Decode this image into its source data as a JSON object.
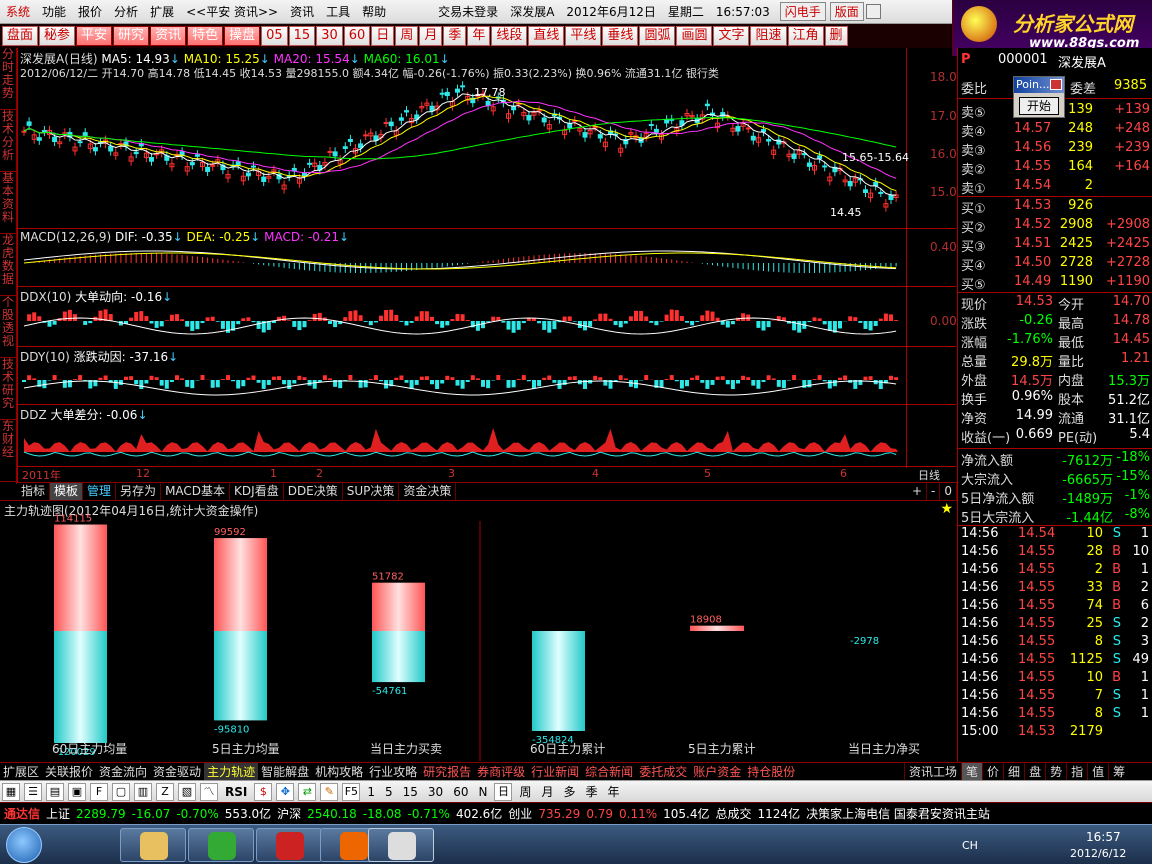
{
  "menu": {
    "items": [
      "系统",
      "功能",
      "报价",
      "分析",
      "扩展",
      "<<平安 资讯>>",
      "资讯",
      "工具",
      "帮助"
    ],
    "login": "交易未登录",
    "stock": "深发展A",
    "date": "2012年6月12日",
    "weekday": "星期二",
    "time": "16:57:03",
    "flash": "闪电手",
    "layout": "版面"
  },
  "toolbar": [
    "盘面",
    "秘参",
    "平安",
    "研究",
    "资讯",
    "特色",
    "操盘",
    "05",
    "15",
    "30",
    "60",
    "日",
    "周",
    "月",
    "季",
    "年",
    "线段",
    "直线",
    "平线",
    "垂线",
    "圆弧",
    "画圆",
    "文字",
    "阻速",
    "江角",
    "删"
  ],
  "logo": {
    "name": "分析家公式网",
    "url": "www.88gs.com"
  },
  "leftnav": [
    "分时走势",
    "技术分析",
    "基本资料",
    "龙虎数据",
    "个股透视",
    "技术研究",
    "东财经"
  ],
  "kline": {
    "title": "深发展A(日线)",
    "ma5": "MA5: 14.93",
    "ma10": "MA10: 15.25",
    "ma20": "MA20: 15.54",
    "ma60": "MA60: 16.01",
    "info": "2012/06/12/二 开14.70 高14.78 低14.45 收14.53 量298155.0 额4.34亿 幅-0.26(-1.76%) 振0.33(2.23%) 换0.96% 流通31.1亿 银行类",
    "high_mark": "17.78",
    "low_mark": "14.45",
    "range_mark": "15.65-15.64",
    "ticks": [
      "18.00",
      "17.00",
      "16.00",
      "15.00"
    ]
  },
  "macd": {
    "title": "MACD(12,26,9)",
    "dif": "DIF: -0.35",
    "dea": "DEA: -0.25",
    "macd": "MACD: -0.21",
    "tick": "0.40"
  },
  "ddx": {
    "title": "DDX(10)",
    "desc": "大单动向: -0.16",
    "tick": "0.00"
  },
  "ddy": {
    "title": "DDY(10)",
    "desc": "涨跌动因: -37.16"
  },
  "ddz": {
    "title": "DDZ",
    "desc": "大单差分: -0.06"
  },
  "xaxis": [
    "2011年",
    "12",
    "1",
    "2",
    "3",
    "4",
    "5",
    "6"
  ],
  "period": "日线",
  "tabs": [
    "指标",
    "模板",
    "管理",
    "另存为",
    "MACD基本",
    "KDJ看盘",
    "DDE决策",
    "SUP决策",
    "资金决策"
  ],
  "flow": {
    "title": "主力轨迹图(2012年04月16日,统计大资金操作)",
    "bars": [
      {
        "label": "60日主力均量",
        "pos": 114115,
        "neg": -120029
      },
      {
        "label": "5日主力均量",
        "pos": 99592,
        "neg": -95810
      },
      {
        "label": "当日主力买卖",
        "pos": 51782,
        "neg": -54761
      },
      {
        "label": "60日主力累计",
        "pos": null,
        "neg": -354824
      },
      {
        "label": "5日主力累计",
        "pos": 18908,
        "neg": null
      },
      {
        "label": "当日主力净买",
        "pos": null,
        "neg": -2978
      }
    ]
  },
  "quote": {
    "code": "000001",
    "name": "深发展A",
    "weibi_label": "委比",
    "weicha_label": "委差",
    "weicha": "9385",
    "sells": [
      {
        "label": "卖⑤",
        "price": "14.58",
        "vol": "139",
        "chg": "+139"
      },
      {
        "label": "卖④",
        "price": "14.57",
        "vol": "248",
        "chg": "+248"
      },
      {
        "label": "卖③",
        "price": "14.56",
        "vol": "239",
        "chg": "+239"
      },
      {
        "label": "卖②",
        "price": "14.55",
        "vol": "164",
        "chg": "+164"
      },
      {
        "label": "卖①",
        "price": "14.54",
        "vol": "2",
        "chg": ""
      }
    ],
    "buys": [
      {
        "label": "买①",
        "price": "14.53",
        "vol": "926",
        "chg": ""
      },
      {
        "label": "买②",
        "price": "14.52",
        "vol": "2908",
        "chg": "+2908"
      },
      {
        "label": "买③",
        "price": "14.51",
        "vol": "2425",
        "chg": "+2425"
      },
      {
        "label": "买④",
        "price": "14.50",
        "vol": "2728",
        "chg": "+2728"
      },
      {
        "label": "买⑤",
        "price": "14.49",
        "vol": "1190",
        "chg": "+1190"
      }
    ],
    "stats": [
      [
        "现价",
        "14.53",
        "今开",
        "14.70"
      ],
      [
        "涨跌",
        "-0.26",
        "最高",
        "14.78"
      ],
      [
        "涨幅",
        "-1.76%",
        "最低",
        "14.45"
      ],
      [
        "总量",
        "29.8万",
        "量比",
        "1.21"
      ],
      [
        "外盘",
        "14.5万",
        "内盘",
        "15.3万"
      ],
      [
        "换手",
        "0.96%",
        "股本",
        "51.2亿"
      ],
      [
        "净资",
        "14.99",
        "流通",
        "31.1亿"
      ],
      [
        "收益(一)",
        "0.669",
        "PE(动)",
        "5.4"
      ]
    ],
    "flows": [
      [
        "净流入额",
        "-7612万",
        "-18%"
      ],
      [
        "大宗流入",
        "-6665万",
        "-15%"
      ],
      [
        "5日净流入额",
        "-1489万",
        "-1%"
      ],
      [
        "5日大宗流入",
        "-1.44亿",
        "-8%"
      ]
    ],
    "ticks": [
      [
        "14:56",
        "14.54",
        "10",
        "S",
        "1"
      ],
      [
        "14:56",
        "14.55",
        "28",
        "B",
        "10"
      ],
      [
        "14:56",
        "14.55",
        "2",
        "B",
        "1"
      ],
      [
        "14:56",
        "14.55",
        "33",
        "B",
        "2"
      ],
      [
        "14:56",
        "14.55",
        "74",
        "B",
        "6"
      ],
      [
        "14:56",
        "14.55",
        "25",
        "S",
        "2"
      ],
      [
        "14:56",
        "14.55",
        "8",
        "S",
        "3"
      ],
      [
        "14:56",
        "14.55",
        "1125",
        "S",
        "49"
      ],
      [
        "14:56",
        "14.55",
        "10",
        "B",
        "1"
      ],
      [
        "14:56",
        "14.55",
        "7",
        "S",
        "1"
      ],
      [
        "14:56",
        "14.55",
        "8",
        "S",
        "1"
      ],
      [
        "15:00",
        "14.53",
        "2179",
        "",
        ""
      ]
    ]
  },
  "popup": {
    "title": "Poin...",
    "button": "开始"
  },
  "funcbar": [
    "扩展区",
    "关联报价",
    "资金流向",
    "资金驱动",
    "主力轨迹",
    "智能解盘",
    "机构攻略",
    "行业攻略",
    "研究报告",
    "券商评级",
    "行业新闻",
    "综合新闻",
    "委托成交",
    "账户资金",
    "持仓股份"
  ],
  "funcbar_right": [
    "资讯工场",
    "笔",
    "价",
    "细",
    "盘",
    "势",
    "指",
    "值",
    "筹"
  ],
  "iconbar": [
    "RSI",
    "F5",
    "1",
    "5",
    "15",
    "30",
    "60",
    "N",
    "日",
    "周",
    "月",
    "多",
    "季",
    "年"
  ],
  "status": {
    "app": "通达信",
    "sh_label": "上证",
    "sh": "2289.79",
    "sh_chg": "-16.07",
    "sh_pct": "-0.70%",
    "sh_amt": "553.0亿",
    "hs_label": "沪深",
    "hs": "2540.18",
    "hs_chg": "-18.08",
    "hs_pct": "-0.71%",
    "hs_amt": "402.6亿",
    "cy_label": "创业",
    "cy": "735.29",
    "cy_chg": "0.79",
    "cy_pct": "0.11%",
    "cy_amt": "105.4亿",
    "total_label": "总成交",
    "total": "1124亿",
    "news": "决策家上海电信 国泰君安资讯主站"
  },
  "taskbar": {
    "time": "16:57",
    "date": "2012/6/12",
    "lang": "CH"
  }
}
